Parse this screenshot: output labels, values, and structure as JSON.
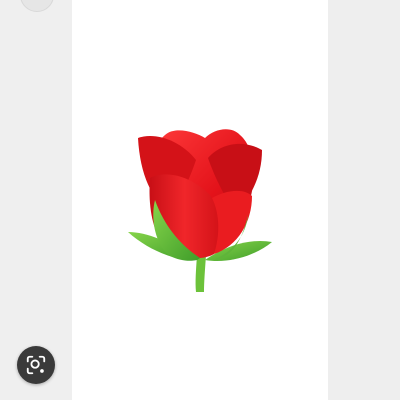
{
  "viewer": {
    "image_subject": "red-rose-bud",
    "lens_button": {
      "icon": "visual-search-icon",
      "background": "#3a3a3a",
      "icon_color": "#ffffff"
    },
    "colors": {
      "petal": "#e3121a",
      "petal_dark": "#b80e16",
      "leaf": "#4fb532",
      "stem": "#6cc23a"
    }
  }
}
